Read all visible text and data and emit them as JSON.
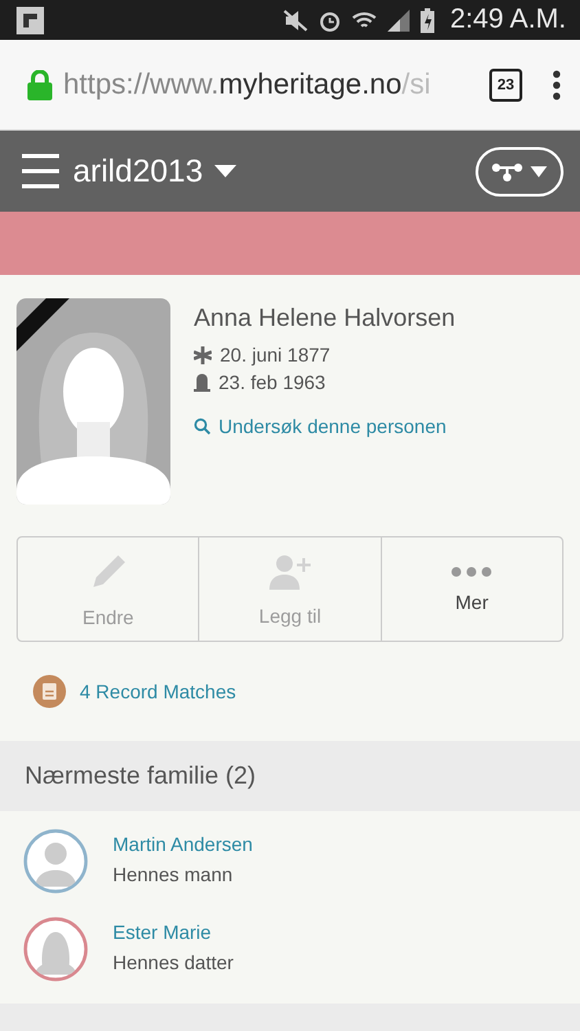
{
  "status_bar": {
    "time": "2:49 A.M."
  },
  "browser": {
    "url_host_prefix": "https://www.",
    "url_domain": "myheritage.no",
    "url_path": "/si",
    "tab_count": "23"
  },
  "header": {
    "site_name": "arild2013"
  },
  "person": {
    "name": "Anna Helene Halvorsen",
    "birth": "20. juni 1877",
    "death": "23. feb 1963",
    "deceased": true,
    "research_link": "Undersøk denne personen"
  },
  "actions": [
    {
      "kind": "edit",
      "label": "Endre",
      "disabled": true
    },
    {
      "kind": "add",
      "label": "Legg til",
      "disabled": true
    },
    {
      "kind": "more",
      "label": "Mer",
      "disabled": false
    }
  ],
  "record_matches": "4 Record Matches",
  "family": {
    "title": "Nærmeste familie (2)",
    "members": [
      {
        "kind": "male",
        "name": "Martin Andersen",
        "relation": "Hennes mann",
        "color": "#8fb4cc"
      },
      {
        "kind": "female",
        "name": "Ester Marie",
        "relation": "Hennes datter",
        "color": "#d9888f"
      }
    ]
  }
}
